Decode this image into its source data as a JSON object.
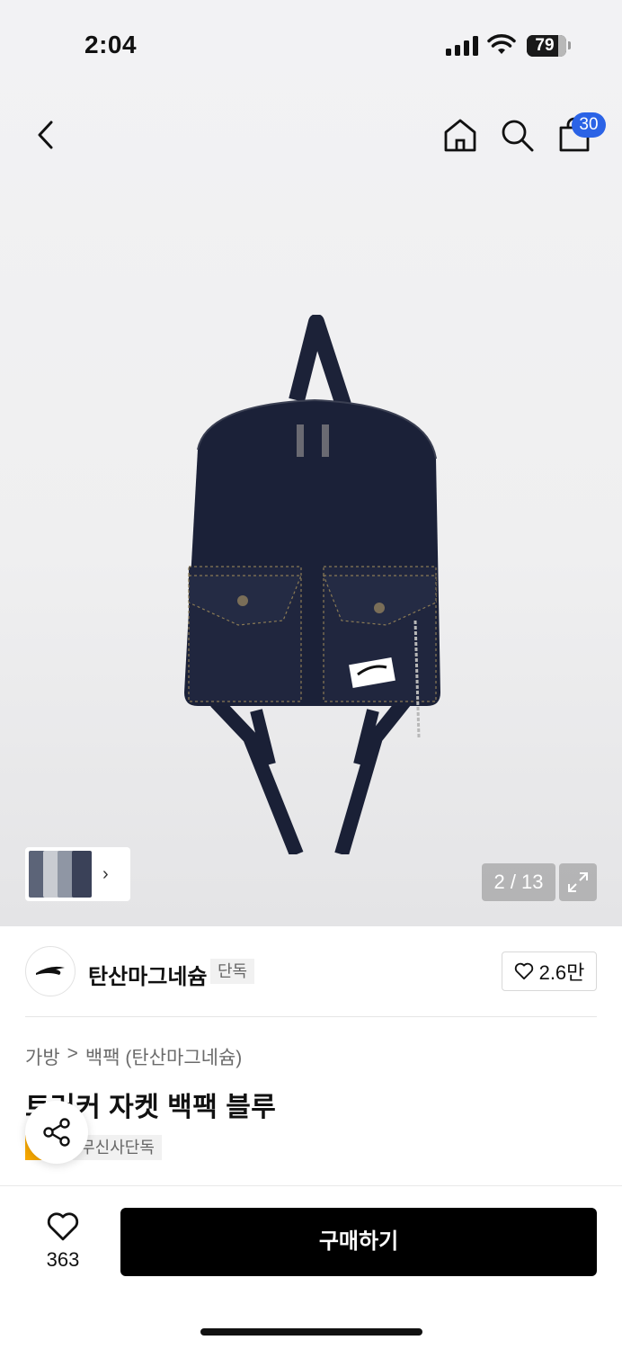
{
  "status": {
    "time": "2:04",
    "battery": "79",
    "battery_level": 0.79
  },
  "nav": {
    "cart_count": "30"
  },
  "gallery": {
    "counter": "2 / 13"
  },
  "brand": {
    "name": "탄산마그네슘",
    "tag": "단독",
    "likes": "2.6만"
  },
  "breadcrumb": {
    "category": "가방",
    "separator": ">",
    "subcategory": "백팩 (탄산마그네슘)"
  },
  "product": {
    "title": "트러커 자켓 백팩 블루",
    "tags": [
      "세일",
      "무신사단독"
    ]
  },
  "bottom": {
    "wish_count": "363",
    "buy_label": "구매하기"
  },
  "colors": {
    "cart_badge": "#2b63e6",
    "sale_tag": "#f7a800",
    "buy_button": "#000000"
  }
}
